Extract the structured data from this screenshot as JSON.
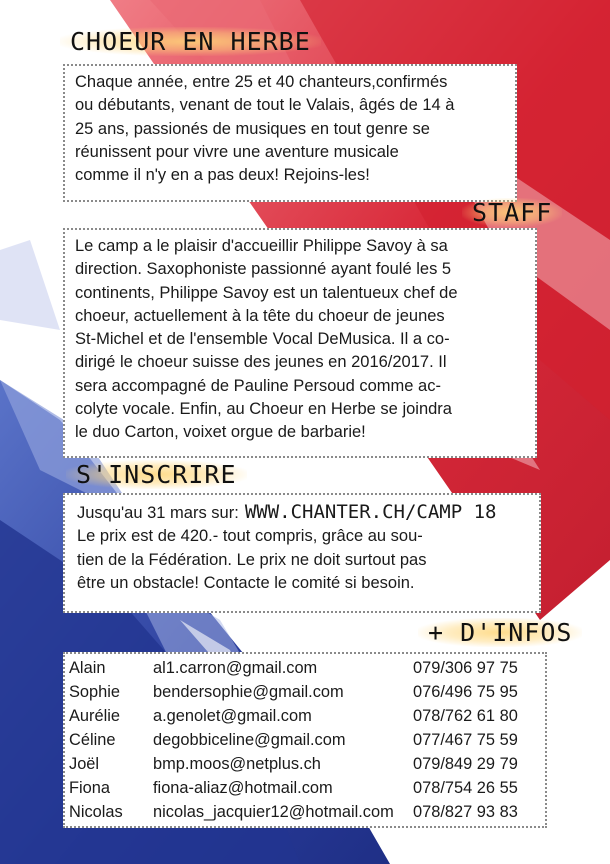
{
  "colors": {
    "blue": "#2a3d9c",
    "red": "#d92a3a",
    "panel": "#ffffff",
    "border": "#8a8a8a"
  },
  "choeur": {
    "title": "CHOEUR EN HERBE",
    "lines": [
      "Chaque année, entre 25 et 40 chanteurs,confirmés",
      "ou débutants, venant de tout le Valais, âgés de 14 à",
      "25 ans, passionés de musiques en tout genre se",
      "réunissent pour vivre une aventure musicale",
      "comme il n'y en a pas deux! Rejoins-les!"
    ]
  },
  "staff": {
    "title": "STAFF",
    "lines": [
      "Le camp a le plaisir d'accueillir Philippe Savoy à sa",
      "direction. Saxophoniste passionné ayant foulé les 5",
      "continents, Philippe Savoy est un talentueux chef de",
      "choeur, actuellement à la tête du choeur de jeunes",
      "St-Michel et de l'ensemble Vocal DeMusica. Il a co-",
      "dirigé le choeur suisse des jeunes en 2016/2017. Il",
      "sera accompagné de Pauline Persoud comme ac-",
      "colyte  vocale. Enfin, au Choeur en Herbe se joindra",
      "le duo Carton, voixet orgue de barbarie!"
    ]
  },
  "inscrire": {
    "title": "S'INSCRIRE",
    "deadline_text": "Jusqu'au 31 mars sur:",
    "url": "WWW.CHANTER.CH/CAMP 18",
    "lines": [
      "Le prix est de 420.- tout compris, grâce au sou-",
      "tien de la Fédération. Le prix ne doit surtout pas",
      "être un obstacle! Contacte le comité si besoin."
    ]
  },
  "infos": {
    "title": "+ D'INFOS",
    "contacts": [
      {
        "name": "Alain",
        "email": "al1.carron@gmail.com",
        "phone": "079/306 97 75"
      },
      {
        "name": "Sophie",
        "email": "bendersophie@gmail.com",
        "phone": "076/496 75 95"
      },
      {
        "name": "Aurélie",
        "email": "a.genolet@gmail.com",
        "phone": "078/762 61 80"
      },
      {
        "name": "Céline",
        "email": "degobbiceline@gmail.com",
        "phone": "077/467 75 59"
      },
      {
        "name": "Joël",
        "email": "bmp.moos@netplus.ch",
        "phone": "079/849 29 79"
      },
      {
        "name": "Fiona",
        "email": "fiona-aliaz@hotmail.com",
        "phone": "078/754 26 55"
      },
      {
        "name": "Nicolas",
        "email": "nicolas_jacquier12@hotmail.com",
        "phone": "078/827 93 83"
      }
    ]
  }
}
